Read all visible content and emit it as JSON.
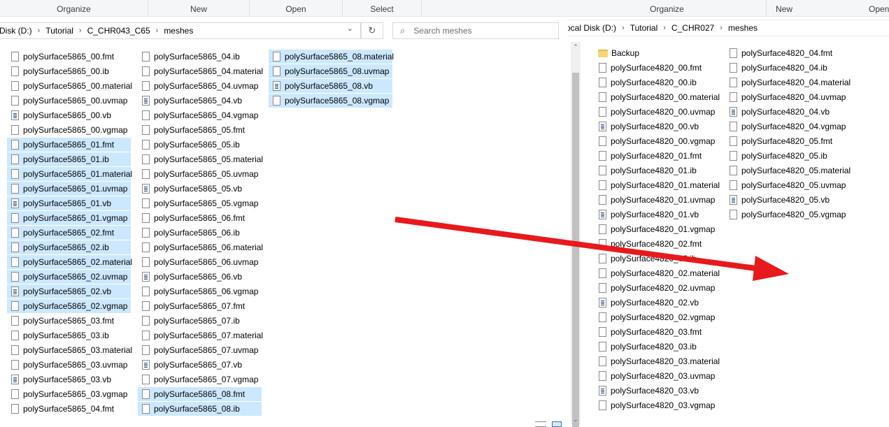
{
  "left_window": {
    "ribbon": [
      "Organize",
      "New",
      "Open",
      "Select"
    ],
    "breadcrumb": [
      "Disk (D:)",
      "Tutorial",
      "C_CHR043_C65",
      "meshes"
    ],
    "search_placeholder": "Search meshes",
    "refresh_icon": "refresh-icon",
    "columns": [
      [
        {
          "name": "polySurface5865_00.fmt",
          "selected": false,
          "icon": "file"
        },
        {
          "name": "polySurface5865_00.ib",
          "selected": false,
          "icon": "file"
        },
        {
          "name": "polySurface5865_00.material",
          "selected": false,
          "icon": "file"
        },
        {
          "name": "polySurface5865_00.uvmap",
          "selected": false,
          "icon": "file"
        },
        {
          "name": "polySurface5865_00.vb",
          "selected": false,
          "icon": "vb"
        },
        {
          "name": "polySurface5865_00.vgmap",
          "selected": false,
          "icon": "file"
        },
        {
          "name": "polySurface5865_01.fmt",
          "selected": true,
          "icon": "file"
        },
        {
          "name": "polySurface5865_01.ib",
          "selected": true,
          "icon": "file"
        },
        {
          "name": "polySurface5865_01.material",
          "selected": true,
          "icon": "file"
        },
        {
          "name": "polySurface5865_01.uvmap",
          "selected": true,
          "icon": "file"
        },
        {
          "name": "polySurface5865_01.vb",
          "selected": true,
          "icon": "vb"
        },
        {
          "name": "polySurface5865_01.vgmap",
          "selected": true,
          "icon": "file"
        },
        {
          "name": "polySurface5865_02.fmt",
          "selected": true,
          "icon": "file"
        },
        {
          "name": "polySurface5865_02.ib",
          "selected": true,
          "icon": "file"
        },
        {
          "name": "polySurface5865_02.material",
          "selected": true,
          "icon": "file"
        },
        {
          "name": "polySurface5865_02.uvmap",
          "selected": true,
          "icon": "file"
        },
        {
          "name": "polySurface5865_02.vb",
          "selected": true,
          "icon": "vb"
        },
        {
          "name": "polySurface5865_02.vgmap",
          "selected": true,
          "icon": "file"
        },
        {
          "name": "polySurface5865_03.fmt",
          "selected": false,
          "icon": "file"
        },
        {
          "name": "polySurface5865_03.ib",
          "selected": false,
          "icon": "file"
        },
        {
          "name": "polySurface5865_03.material",
          "selected": false,
          "icon": "file"
        },
        {
          "name": "polySurface5865_03.uvmap",
          "selected": false,
          "icon": "file"
        },
        {
          "name": "polySurface5865_03.vb",
          "selected": false,
          "icon": "vb"
        },
        {
          "name": "polySurface5865_03.vgmap",
          "selected": false,
          "icon": "file"
        },
        {
          "name": "polySurface5865_04.fmt",
          "selected": false,
          "icon": "file"
        }
      ],
      [
        {
          "name": "polySurface5865_04.ib",
          "selected": false,
          "icon": "file"
        },
        {
          "name": "polySurface5865_04.material",
          "selected": false,
          "icon": "file"
        },
        {
          "name": "polySurface5865_04.uvmap",
          "selected": false,
          "icon": "file"
        },
        {
          "name": "polySurface5865_04.vb",
          "selected": false,
          "icon": "vb"
        },
        {
          "name": "polySurface5865_04.vgmap",
          "selected": false,
          "icon": "file"
        },
        {
          "name": "polySurface5865_05.fmt",
          "selected": false,
          "icon": "file"
        },
        {
          "name": "polySurface5865_05.ib",
          "selected": false,
          "icon": "file"
        },
        {
          "name": "polySurface5865_05.material",
          "selected": false,
          "icon": "file"
        },
        {
          "name": "polySurface5865_05.uvmap",
          "selected": false,
          "icon": "file"
        },
        {
          "name": "polySurface5865_05.vb",
          "selected": false,
          "icon": "vb"
        },
        {
          "name": "polySurface5865_05.vgmap",
          "selected": false,
          "icon": "file"
        },
        {
          "name": "polySurface5865_06.fmt",
          "selected": false,
          "icon": "file"
        },
        {
          "name": "polySurface5865_06.ib",
          "selected": false,
          "icon": "file"
        },
        {
          "name": "polySurface5865_06.material",
          "selected": false,
          "icon": "file"
        },
        {
          "name": "polySurface5865_06.uvmap",
          "selected": false,
          "icon": "file"
        },
        {
          "name": "polySurface5865_06.vb",
          "selected": false,
          "icon": "vb"
        },
        {
          "name": "polySurface5865_06.vgmap",
          "selected": false,
          "icon": "file"
        },
        {
          "name": "polySurface5865_07.fmt",
          "selected": false,
          "icon": "file"
        },
        {
          "name": "polySurface5865_07.ib",
          "selected": false,
          "icon": "file"
        },
        {
          "name": "polySurface5865_07.material",
          "selected": false,
          "icon": "file"
        },
        {
          "name": "polySurface5865_07.uvmap",
          "selected": false,
          "icon": "file"
        },
        {
          "name": "polySurface5865_07.vb",
          "selected": false,
          "icon": "vb"
        },
        {
          "name": "polySurface5865_07.vgmap",
          "selected": false,
          "icon": "file"
        },
        {
          "name": "polySurface5865_08.fmt",
          "selected": true,
          "icon": "file"
        },
        {
          "name": "polySurface5865_08.ib",
          "selected": true,
          "icon": "file"
        }
      ],
      [
        {
          "name": "polySurface5865_08.material",
          "selected": true,
          "icon": "file"
        },
        {
          "name": "polySurface5865_08.uvmap",
          "selected": true,
          "icon": "file"
        },
        {
          "name": "polySurface5865_08.vb",
          "selected": true,
          "icon": "vb"
        },
        {
          "name": "polySurface5865_08.vgmap",
          "selected": true,
          "icon": "file"
        }
      ]
    ]
  },
  "right_window": {
    "ribbon": [
      "Organize",
      "New",
      "Open"
    ],
    "breadcrumb": [
      "ocal Disk (D:)",
      "Tutorial",
      "C_CHR027",
      "meshes"
    ],
    "columns": [
      [
        {
          "name": "Backup",
          "selected": false,
          "icon": "folder"
        },
        {
          "name": "polySurface4820_00.fmt",
          "selected": false,
          "icon": "file"
        },
        {
          "name": "polySurface4820_00.ib",
          "selected": false,
          "icon": "file"
        },
        {
          "name": "polySurface4820_00.material",
          "selected": false,
          "icon": "file"
        },
        {
          "name": "polySurface4820_00.uvmap",
          "selected": false,
          "icon": "file"
        },
        {
          "name": "polySurface4820_00.vb",
          "selected": false,
          "icon": "vb"
        },
        {
          "name": "polySurface4820_00.vgmap",
          "selected": false,
          "icon": "file"
        },
        {
          "name": "polySurface4820_01.fmt",
          "selected": false,
          "icon": "file"
        },
        {
          "name": "polySurface4820_01.ib",
          "selected": false,
          "icon": "file"
        },
        {
          "name": "polySurface4820_01.material",
          "selected": false,
          "icon": "file"
        },
        {
          "name": "polySurface4820_01.uvmap",
          "selected": false,
          "icon": "file"
        },
        {
          "name": "polySurface4820_01.vb",
          "selected": false,
          "icon": "vb"
        },
        {
          "name": "polySurface4820_01.vgmap",
          "selected": false,
          "icon": "file"
        },
        {
          "name": "polySurface4820_02.fmt",
          "selected": false,
          "icon": "file"
        },
        {
          "name": "polySurface4820_02.ib",
          "selected": false,
          "icon": "file"
        },
        {
          "name": "polySurface4820_02.material",
          "selected": false,
          "icon": "file"
        },
        {
          "name": "polySurface4820_02.uvmap",
          "selected": false,
          "icon": "file"
        },
        {
          "name": "polySurface4820_02.vb",
          "selected": false,
          "icon": "vb"
        },
        {
          "name": "polySurface4820_02.vgmap",
          "selected": false,
          "icon": "file"
        },
        {
          "name": "polySurface4820_03.fmt",
          "selected": false,
          "icon": "file"
        },
        {
          "name": "polySurface4820_03.ib",
          "selected": false,
          "icon": "file"
        },
        {
          "name": "polySurface4820_03.material",
          "selected": false,
          "icon": "file"
        },
        {
          "name": "polySurface4820_03.uvmap",
          "selected": false,
          "icon": "file"
        },
        {
          "name": "polySurface4820_03.vb",
          "selected": false,
          "icon": "vb"
        },
        {
          "name": "polySurface4820_03.vgmap",
          "selected": false,
          "icon": "file"
        }
      ],
      [
        {
          "name": "polySurface4820_04.fmt",
          "selected": false,
          "icon": "file"
        },
        {
          "name": "polySurface4820_04.ib",
          "selected": false,
          "icon": "file"
        },
        {
          "name": "polySurface4820_04.material",
          "selected": false,
          "icon": "file"
        },
        {
          "name": "polySurface4820_04.uvmap",
          "selected": false,
          "icon": "file"
        },
        {
          "name": "polySurface4820_04.vb",
          "selected": false,
          "icon": "vb"
        },
        {
          "name": "polySurface4820_04.vgmap",
          "selected": false,
          "icon": "file"
        },
        {
          "name": "polySurface4820_05.fmt",
          "selected": false,
          "icon": "file"
        },
        {
          "name": "polySurface4820_05.ib",
          "selected": false,
          "icon": "file"
        },
        {
          "name": "polySurface4820_05.material",
          "selected": false,
          "icon": "file"
        },
        {
          "name": "polySurface4820_05.uvmap",
          "selected": false,
          "icon": "file"
        },
        {
          "name": "polySurface4820_05.vb",
          "selected": false,
          "icon": "vb"
        },
        {
          "name": "polySurface4820_05.vgmap",
          "selected": false,
          "icon": "file"
        }
      ]
    ]
  },
  "annotation": {
    "arrow_color": "#e8191c",
    "arrow_icon": "red-arrow-annotation"
  },
  "colors": {
    "selection": "#cce8ff",
    "ribbon_bg": "#f5f6f7"
  }
}
